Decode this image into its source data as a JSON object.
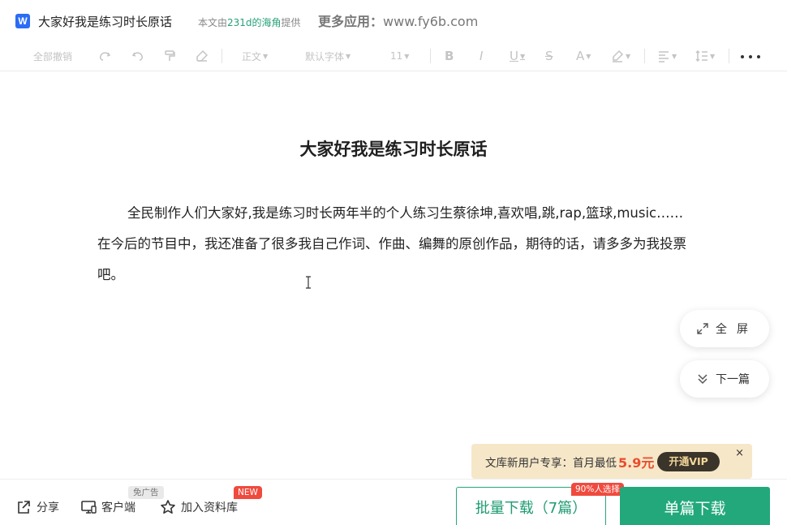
{
  "titlebar": {
    "logo_letter": "W",
    "doc_title": "大家好我是练习时长原话",
    "provided_prefix": "本文由",
    "provided_author": "231d的海角",
    "provided_suffix": "提供",
    "more_apps_label": "更多应用：",
    "more_apps_url": "www.fy6b.com"
  },
  "toolbar": {
    "undo_all": "全部撤销",
    "style": "正文",
    "font": "默认字体",
    "size": "11"
  },
  "document": {
    "heading": "大家好我是练习时长原话",
    "paragraph": "全民制作人们大家好,我是练习时长两年半的个人练习生蔡徐坤,喜欢唱,跳,rap,篮球,music……在今后的节目中，我还准备了很多我自己作词、作曲、编舞的原创作品，期待的话，请多多为我投票吧。"
  },
  "floating": {
    "fullscreen": "全屏",
    "next": "下一篇"
  },
  "promo": {
    "text": "文库新用户专享：首月最低",
    "price": "5.9元",
    "vip_button": "开通VIP",
    "close": "×"
  },
  "bottom": {
    "share": "分享",
    "client": "客户端",
    "client_tag": "免广告",
    "add_library": "加入资料库",
    "new_tag": "NEW",
    "batch_download": "批量下载（7篇）",
    "batch_tag": "90%人选择",
    "single_download": "单篇下载"
  },
  "colors": {
    "brand_blue": "#2b6cf6",
    "green": "#22a87b",
    "red_tag": "#f04a3e",
    "promo_bg": "#f6e7c8",
    "price": "#e84d2e"
  }
}
